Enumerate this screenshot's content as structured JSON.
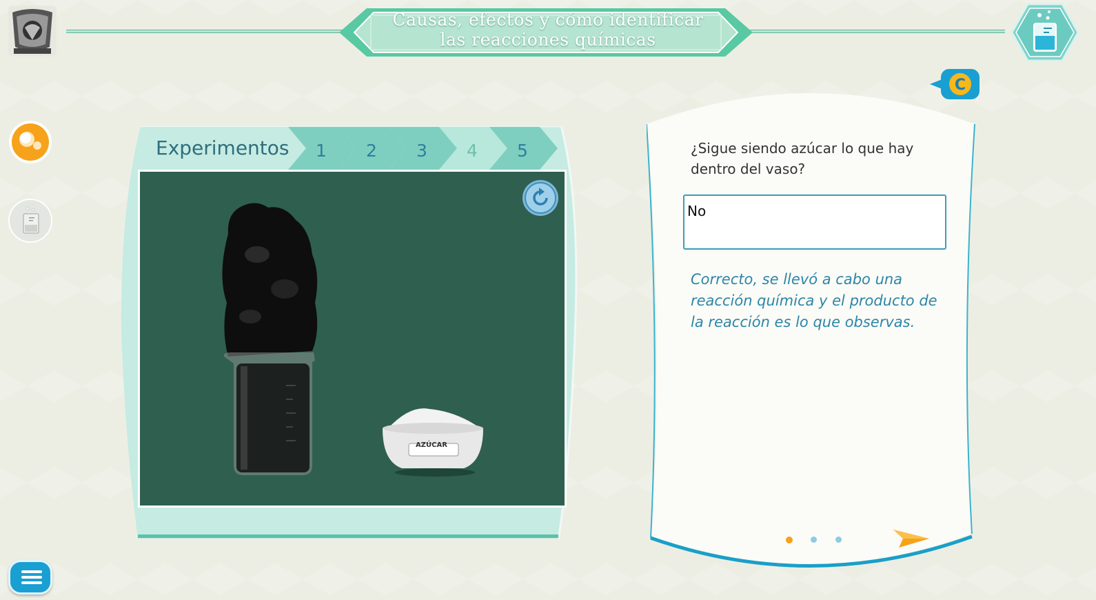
{
  "header": {
    "title_line1": "Causas, efectos y cómo identificar",
    "title_line2": "las reacciones químicas"
  },
  "logo": {
    "icon": "unam-crest-icon"
  },
  "sidebar": {
    "items": [
      {
        "icon": "bubbles-icon",
        "active": true
      },
      {
        "icon": "beaker-icon",
        "active": false
      }
    ],
    "menu_icon": "hamburger-menu-icon"
  },
  "experiments": {
    "label": "Experimentos",
    "tabs": [
      "1",
      "2",
      "3",
      "4",
      "5"
    ],
    "current_tab": "4",
    "beaker_label": "AZÚCAR"
  },
  "question_card": {
    "badge": "C",
    "question": "¿Sigue siendo azúcar lo que hay dentro del vaso?",
    "answer_value": "No",
    "feedback": "Correcto, se llevó a cabo una reacción química y el producto de la reacción es lo que observas.",
    "pager": {
      "pages": 3,
      "current": 1
    }
  },
  "colors": {
    "accent_teal": "#6ccfb2",
    "stage_green": "#2f5f4f",
    "blue": "#1a9fd2",
    "orange": "#f7a21b"
  }
}
